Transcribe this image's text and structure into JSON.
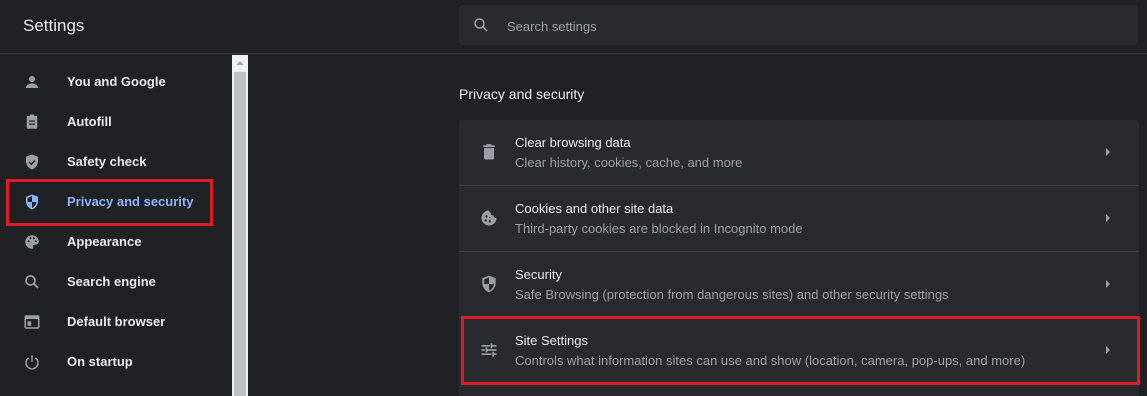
{
  "header": {
    "title": "Settings",
    "search_placeholder": "Search settings",
    "search_value": ""
  },
  "sidebar": {
    "items": [
      {
        "label": "You and Google",
        "icon": "person-icon"
      },
      {
        "label": "Autofill",
        "icon": "clipboard-icon"
      },
      {
        "label": "Safety check",
        "icon": "shield-check-icon"
      },
      {
        "label": "Privacy and security",
        "icon": "shield-icon",
        "active": true
      },
      {
        "label": "Appearance",
        "icon": "palette-icon"
      },
      {
        "label": "Search engine",
        "icon": "search-icon"
      },
      {
        "label": "Default browser",
        "icon": "browser-icon"
      },
      {
        "label": "On startup",
        "icon": "power-icon"
      }
    ]
  },
  "main": {
    "section_title": "Privacy and security",
    "rows": [
      {
        "title": "Clear browsing data",
        "subtitle": "Clear history, cookies, cache, and more",
        "icon": "trash-icon"
      },
      {
        "title": "Cookies and other site data",
        "subtitle": "Third-party cookies are blocked in Incognito mode",
        "icon": "cookie-icon"
      },
      {
        "title": "Security",
        "subtitle": "Safe Browsing (protection from dangerous sites) and other security settings",
        "icon": "shield-icon"
      },
      {
        "title": "Site Settings",
        "subtitle": "Controls what information sites can use and show (location, camera, pop-ups, and more)",
        "icon": "tune-icon"
      }
    ]
  },
  "colors": {
    "background": "#202124",
    "card": "#292a2d",
    "accent": "#8ab4f8",
    "highlight": "#e01b24"
  }
}
